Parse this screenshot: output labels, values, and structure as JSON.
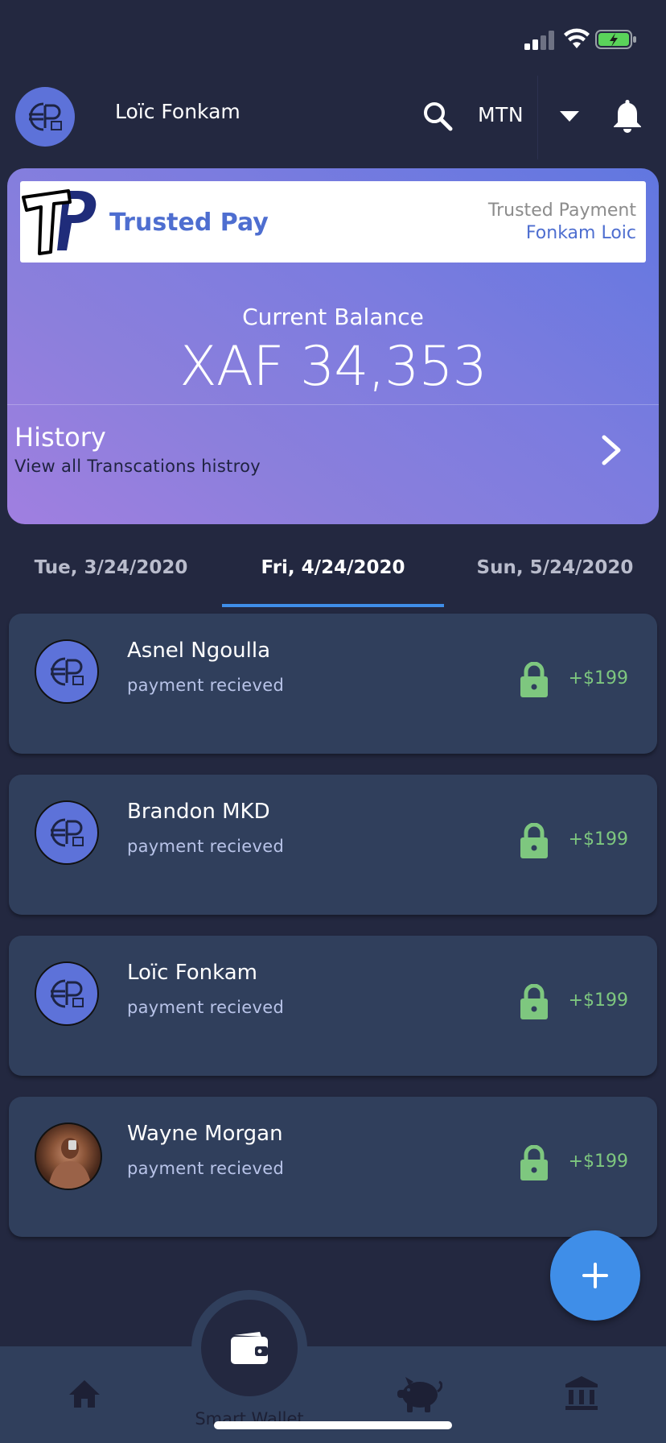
{
  "header": {
    "user_name": "Loïc Fonkam",
    "carrier": "MTN"
  },
  "card": {
    "brand_name": "Trusted Pay",
    "brand_sub1": "Trusted Payment",
    "brand_sub2": "Fonkam Loic",
    "balance_label": "Current Balance",
    "balance_value": "XAF 34,353",
    "history_title": "History",
    "history_sub": "View all Transcations histroy"
  },
  "tabs": [
    {
      "label": "Tue, 3/24/2020",
      "active": false
    },
    {
      "label": "Fri, 4/24/2020",
      "active": true
    },
    {
      "label": "Sun, 5/24/2020",
      "active": false
    }
  ],
  "transactions": [
    {
      "name": "Asnel Ngoulla",
      "status": "payment recieved",
      "amount": "+$199",
      "avatar": "logo"
    },
    {
      "name": "Brandon MKD",
      "status": "payment recieved",
      "amount": "+$199",
      "avatar": "logo"
    },
    {
      "name": "Loïc Fonkam",
      "status": "payment recieved",
      "amount": "+$199",
      "avatar": "logo"
    },
    {
      "name": "Wayne Morgan",
      "status": "payment recieved",
      "amount": "+$199",
      "avatar": "photo"
    }
  ],
  "bottom_nav": {
    "center_label": "Smart Wallet"
  },
  "colors": {
    "accent": "#3f8ee8",
    "amount": "#7ec77f",
    "background": "#232840",
    "card_bg": "#303f5c"
  },
  "icons": [
    "signal-icon",
    "wifi-icon",
    "battery-icon",
    "search-icon",
    "dropdown-icon",
    "bell-icon",
    "chevron-right-icon",
    "lock-icon",
    "plus-icon",
    "wallet-icon",
    "home-icon",
    "piggy-bank-icon",
    "bank-icon"
  ]
}
